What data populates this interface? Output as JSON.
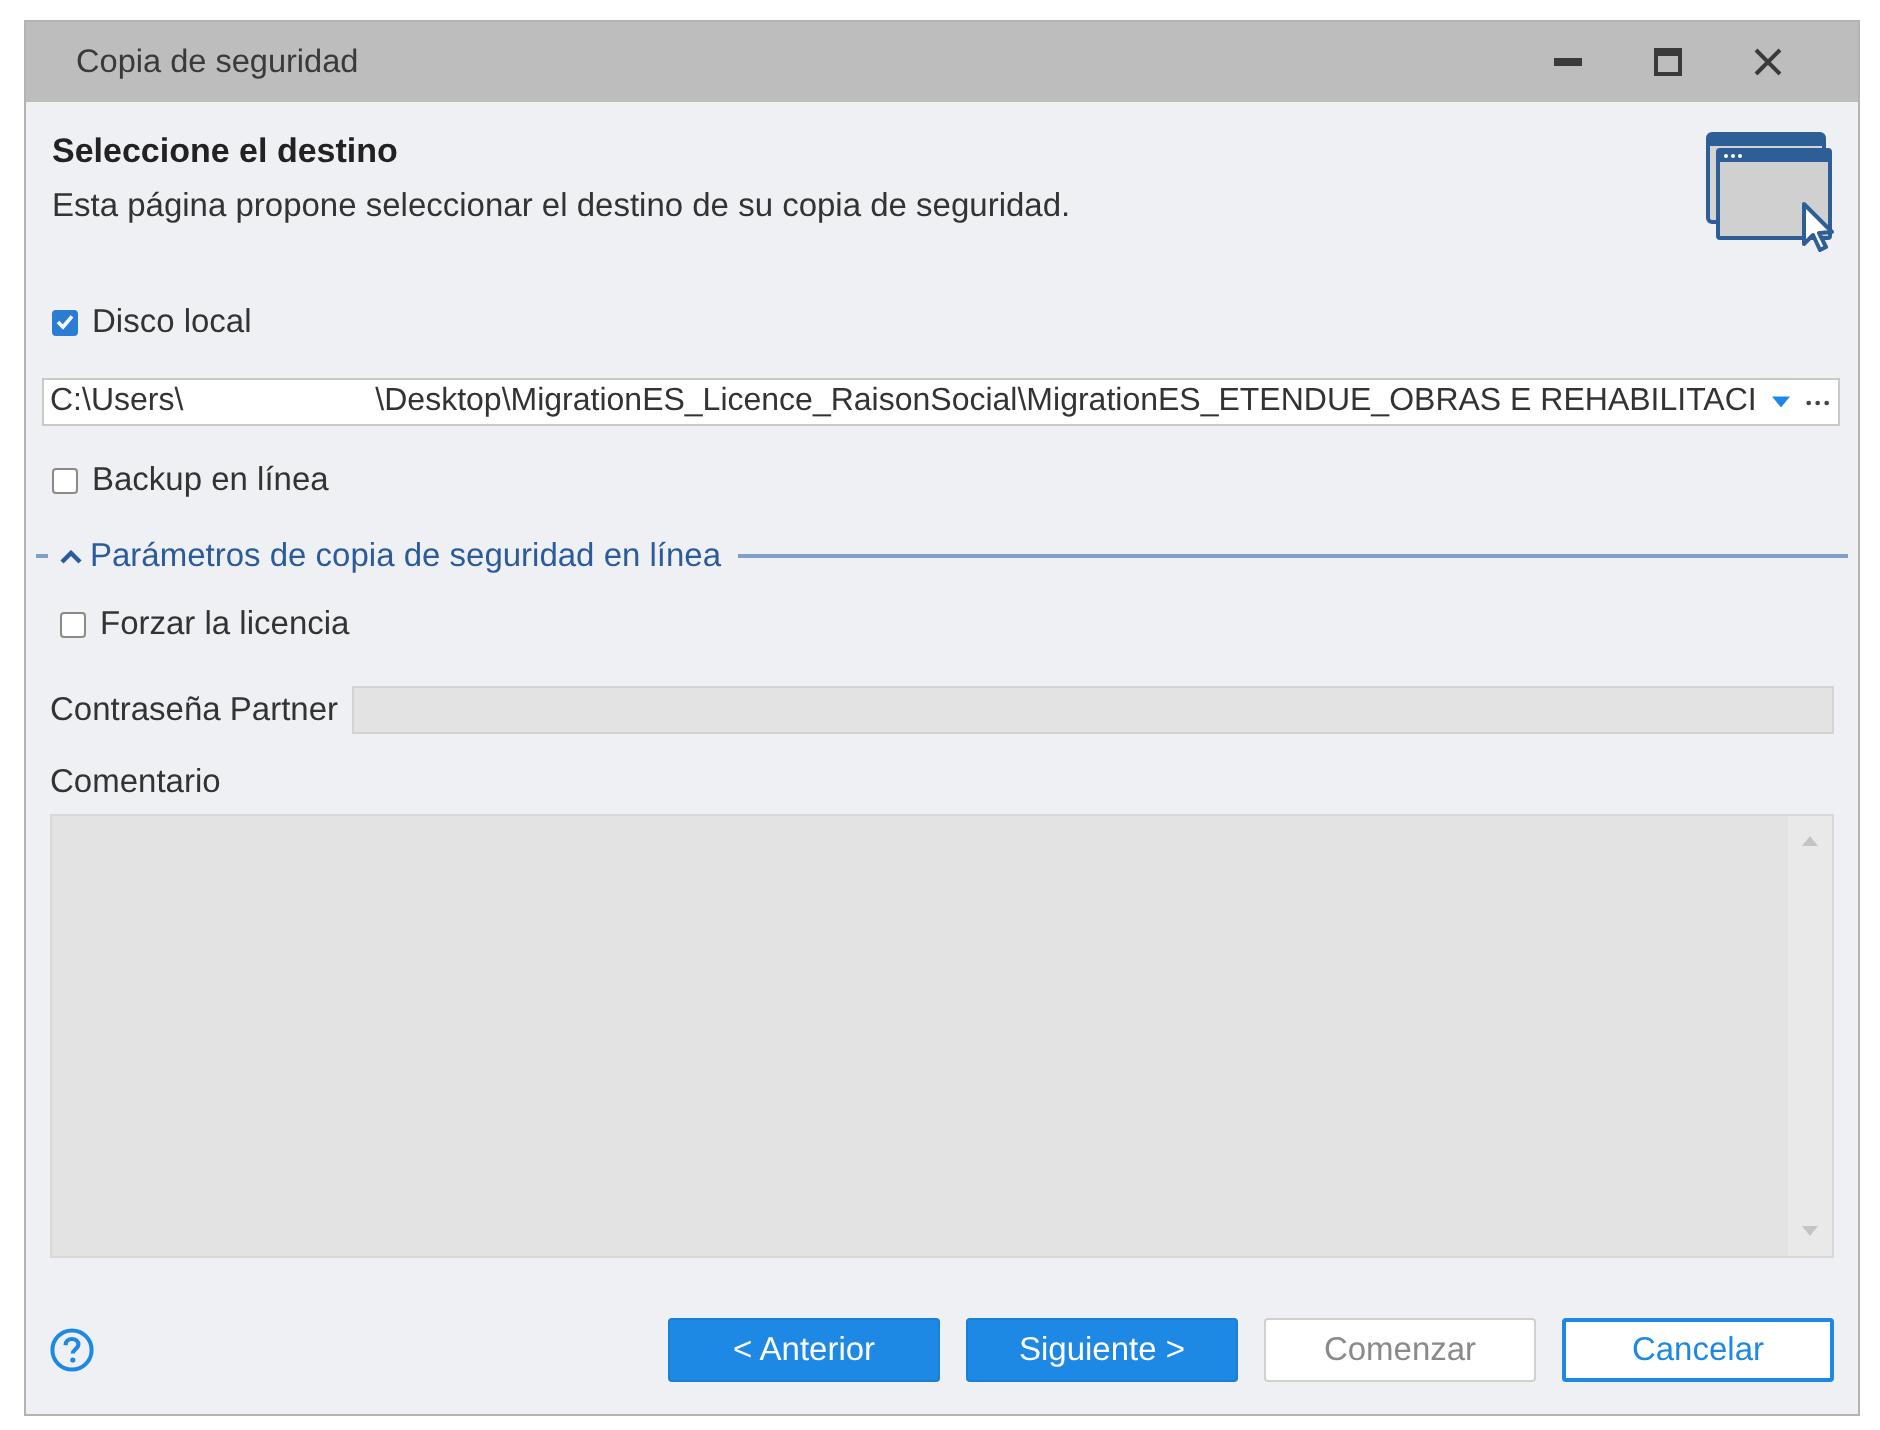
{
  "window": {
    "title": "Copia de seguridad"
  },
  "header": {
    "title": "Seleccione el destino",
    "subtitle": "Esta página propone seleccionar el destino de su copia de seguridad."
  },
  "local_disk": {
    "label": "Disco local",
    "checked": true
  },
  "destination_path": {
    "segments": [
      {
        "kind": "text",
        "text": "C:\\Users\\"
      },
      {
        "kind": "redacted"
      },
      {
        "kind": "text",
        "text": "\\Desktop\\MigrationES_Licence_RaisonSocial\\MigrationES_ETENDUE_OBRAS E REHABILITACI"
      }
    ]
  },
  "online_backup": {
    "label": "Backup en línea",
    "checked": false
  },
  "online_section": {
    "title": "Parámetros de copia de seguridad en línea",
    "expanded": true,
    "force_license": {
      "label": "Forzar la licencia",
      "checked": false
    },
    "partner_password": {
      "label": "Contraseña Partner",
      "disabled": true
    },
    "comment": {
      "label": "Comentario",
      "disabled": true
    }
  },
  "buttons": [
    {
      "label": "< Anterior",
      "kind": "primary",
      "disabled": false,
      "focused": false
    },
    {
      "label": "Siguiente >",
      "kind": "primary",
      "disabled": false,
      "focused": false
    },
    {
      "label": "Comenzar",
      "kind": "default",
      "disabled": true,
      "focused": false
    },
    {
      "label": "Cancelar",
      "kind": "default",
      "disabled": false,
      "focused": true
    }
  ]
}
